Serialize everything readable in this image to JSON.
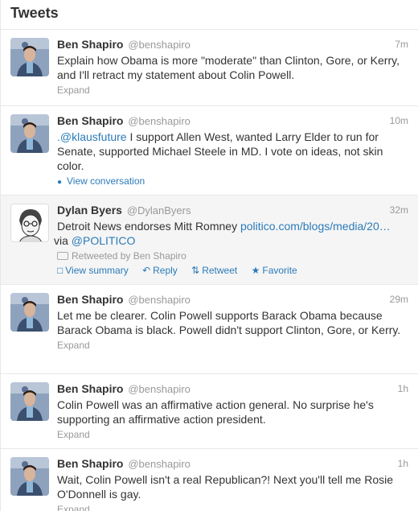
{
  "header": {
    "title": "Tweets"
  },
  "tweets": [
    {
      "fullname": "Ben Shapiro",
      "username": "@benshapiro",
      "time": "7m",
      "text": "Explain how Obama is more \"moderate\" than Clinton, Gore, or Kerry, and I'll retract my statement about Colin Powell.",
      "meta": "Expand"
    },
    {
      "fullname": "Ben Shapiro",
      "username": "@benshapiro",
      "time": "10m",
      "mention": ".@klausfuture",
      "text": " I support Allen West, wanted Larry Elder to run for Senate, supported Michael Steele in MD. I vote on ideas, not skin color.",
      "meta": "View conversation"
    },
    {
      "fullname": "Dylan Byers",
      "username": "@DylanByers",
      "time": "32m",
      "text_a": "Detroit News endorses Mitt Romney ",
      "link": "politico.com/blogs/media/20…",
      "text_b": " via ",
      "via": "@POLITICO",
      "retweeted_by": "Retweeted by Ben Shapiro",
      "actions": {
        "summary": "View summary",
        "reply": "Reply",
        "retweet": "Retweet",
        "favorite": "Favorite"
      }
    },
    {
      "fullname": "Ben Shapiro",
      "username": "@benshapiro",
      "time": "29m",
      "text": "Let me be clearer. Colin Powell supports Barack Obama because Barack Obama is black. Powell didn't support Clinton, Gore, or Kerry.",
      "meta": "Expand"
    },
    {
      "fullname": "Ben Shapiro",
      "username": "@benshapiro",
      "time": "1h",
      "text": "Colin Powell was an affirmative action general. No surprise he's supporting an affirmative action president.",
      "meta": "Expand"
    },
    {
      "fullname": "Ben Shapiro",
      "username": "@benshapiro",
      "time": "1h",
      "text": "Wait, Colin Powell isn't a real Republican?! Next you'll tell me Rosie O'Donnell is gay.",
      "meta": "Expand"
    }
  ],
  "colors": {
    "link": "#2b7bb9",
    "muted": "#999999",
    "highlight_bg": "#f5f5f5"
  },
  "icons": {
    "conversation": "speech-bubble-icon",
    "summary": "document-icon",
    "reply": "reply-arrow-icon",
    "retweet": "retweet-icon",
    "favorite": "star-icon"
  }
}
